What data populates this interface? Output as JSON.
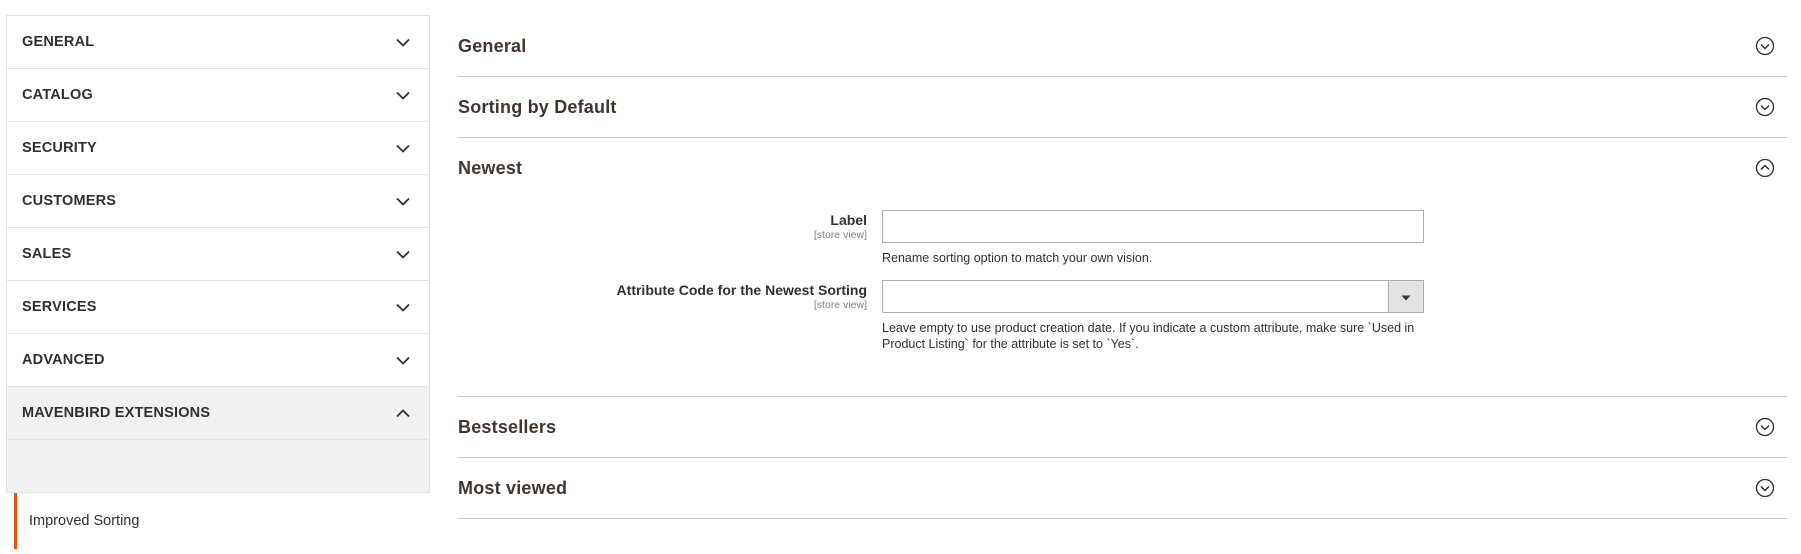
{
  "sidebar": {
    "groups": [
      {
        "label": "GENERAL",
        "expanded": false
      },
      {
        "label": "CATALOG",
        "expanded": false
      },
      {
        "label": "SECURITY",
        "expanded": false
      },
      {
        "label": "CUSTOMERS",
        "expanded": false
      },
      {
        "label": "SALES",
        "expanded": false
      },
      {
        "label": "SERVICES",
        "expanded": false
      },
      {
        "label": "ADVANCED",
        "expanded": false
      },
      {
        "label": "MAVENBIRD EXTENSIONS",
        "expanded": true
      }
    ],
    "active_item": "Improved Sorting",
    "accent_color": "#eb5202",
    "icons": {
      "collapsed": "chevron-down-icon",
      "expanded": "chevron-up-icon"
    }
  },
  "main": {
    "sections": [
      {
        "title": "General",
        "expanded": false
      },
      {
        "title": "Sorting by Default",
        "expanded": false
      },
      {
        "title": "Newest",
        "expanded": true
      },
      {
        "title": "Bestsellers",
        "expanded": false
      },
      {
        "title": "Most viewed",
        "expanded": false
      }
    ],
    "newest": {
      "label_field": {
        "label": "Label",
        "scope": "[store view]",
        "value": "",
        "note": "Rename sorting option to match your own vision."
      },
      "attribute_field": {
        "label": "Attribute Code for the Newest Sorting",
        "scope": "[store view]",
        "value": "",
        "note_line1": "Leave empty to use product creation date. If you indicate a custom attribute, make sure `Used in",
        "note_line2": "Product Listing` for the attribute is set to `Yes`."
      }
    },
    "icons": {
      "collapsed": "circle-chevron-down-icon",
      "expanded": "circle-chevron-up-icon"
    }
  }
}
